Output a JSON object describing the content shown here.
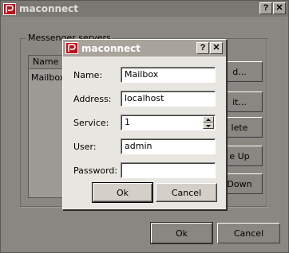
{
  "main_window": {
    "title": "maconnect",
    "help_btn": "?",
    "close_btn": "✕",
    "groupbox_label": "Messenger servers",
    "list_header": "Name",
    "list_items": [
      "Mailbox"
    ],
    "side_buttons": [
      "d...",
      "it...",
      "lete",
      "e Up",
      "Down"
    ],
    "ok_label": "Ok",
    "cancel_label": "Cancel"
  },
  "dialog": {
    "title": "maconnect",
    "help_btn": "?",
    "close_btn": "✕",
    "name_label": "Name:",
    "name_value": "Mailbox",
    "address_label": "Address:",
    "address_value": "localhost",
    "service_label": "Service:",
    "service_value": "1",
    "user_label": "User:",
    "user_value": "admin",
    "password_label": "Password:",
    "password_value": "",
    "ok_label": "Ok",
    "cancel_label": "Cancel"
  },
  "colors": {
    "main_title_bg": "#7a7872",
    "main_body_bg": "#8a8782",
    "dialog_title_bg": "#a8a49c",
    "dialog_body_bg": "#e8e6e0",
    "icon_red": "#c0101c"
  }
}
